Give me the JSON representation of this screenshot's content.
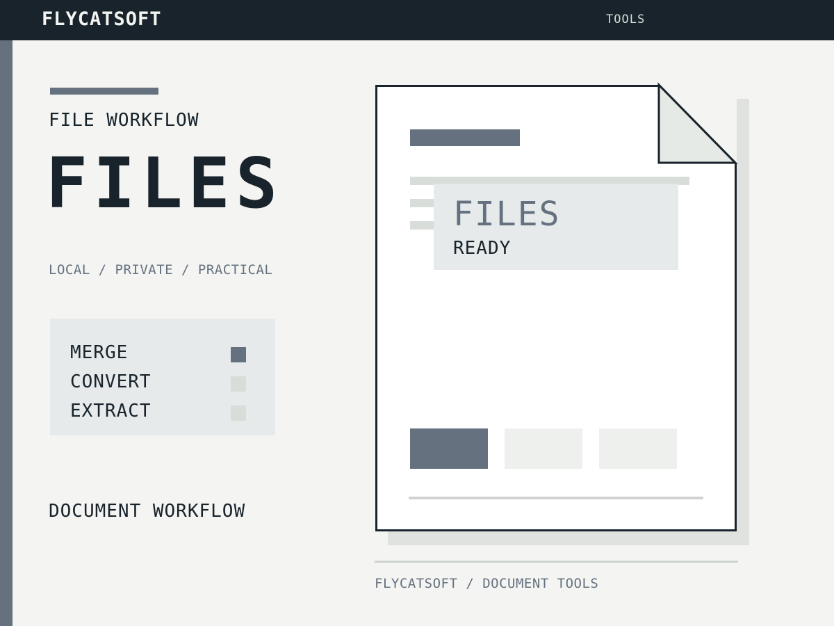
{
  "header": {
    "brand": "FLYCATSOFT",
    "nav": {
      "tools_label": "TOOLS"
    }
  },
  "hero": {
    "eyebrow": "FILE WORKFLOW",
    "title": "FILES",
    "tagline": "LOCAL / PRIVATE / PRACTICAL"
  },
  "operations": [
    {
      "label": "MERGE",
      "selected": true
    },
    {
      "label": "CONVERT",
      "selected": false
    },
    {
      "label": "EXTRACT",
      "selected": false
    }
  ],
  "footer_left": "DOCUMENT WORKFLOW",
  "document_preview": {
    "status_title": "FILES",
    "status_sub": "READY"
  },
  "caption": "FLYCATSOFT / DOCUMENT TOOLS",
  "colors": {
    "dark": "#18232b",
    "accent": "#65717f",
    "background": "#f4f5f2",
    "panel": "#e6eaeb"
  }
}
